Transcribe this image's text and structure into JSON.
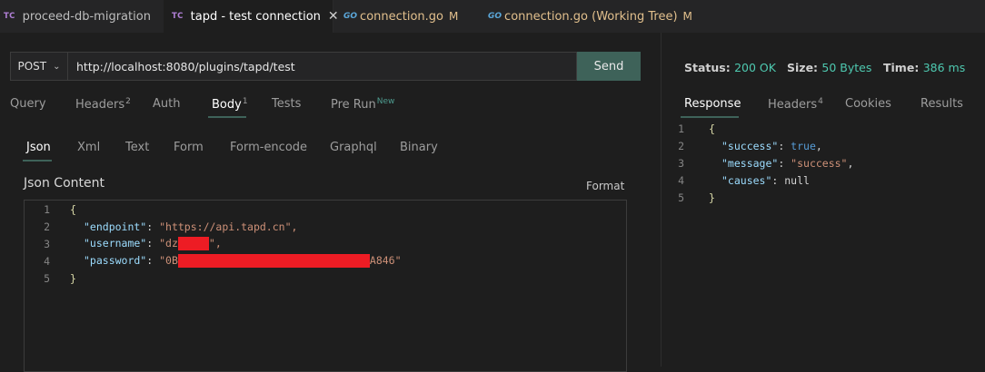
{
  "tabs": [
    {
      "icon": "TC",
      "label": "proceed-db-migration"
    },
    {
      "icon": "TC",
      "label": "tapd - test connection"
    },
    {
      "icon": "GO",
      "label": "connection.go",
      "modified": "M"
    },
    {
      "icon": "GO",
      "label": "connection.go (Working Tree)",
      "modified": "M"
    }
  ],
  "request": {
    "method": "POST",
    "url": "http://localhost:8080/plugins/tapd/test",
    "send_label": "Send"
  },
  "request_tabs": [
    {
      "label": "Query"
    },
    {
      "label": "Headers",
      "badge": "2"
    },
    {
      "label": "Auth"
    },
    {
      "label": "Body",
      "badge": "1"
    },
    {
      "label": "Tests"
    },
    {
      "label": "Pre Run",
      "badge": "New"
    }
  ],
  "body_tabs": [
    "Json",
    "Xml",
    "Text",
    "Form",
    "Form-encode",
    "Graphql",
    "Binary"
  ],
  "json_content": {
    "title": "Json Content",
    "format_label": "Format",
    "lines": [
      {
        "n": "1",
        "brace": "{"
      },
      {
        "n": "2",
        "key": "\"endpoint\"",
        "value": "\"https://api.tapd.cn\","
      },
      {
        "n": "3",
        "key": "\"username\"",
        "value_start": "\"dz",
        "value_end": "\","
      },
      {
        "n": "4",
        "key": "\"password\"",
        "value_start": "\"0B",
        "value_end": "A846\""
      },
      {
        "n": "5",
        "brace": "}"
      }
    ]
  },
  "response": {
    "status_label": "Status:",
    "status_value": "200 OK",
    "size_label": "Size:",
    "size_value": "50 Bytes",
    "time_label": "Time:",
    "time_value": "386 ms",
    "tabs": [
      {
        "label": "Response"
      },
      {
        "label": "Headers",
        "badge": "4"
      },
      {
        "label": "Cookies"
      },
      {
        "label": "Results"
      }
    ],
    "lines": [
      {
        "n": "1",
        "brace": "{"
      },
      {
        "n": "2",
        "key": "\"success\"",
        "value": "true",
        "tail": ","
      },
      {
        "n": "3",
        "key": "\"message\"",
        "value": "\"success\"",
        "tail": ","
      },
      {
        "n": "4",
        "key": "\"causes\"",
        "value": "null",
        "tail": ""
      },
      {
        "n": "5",
        "brace": "}"
      }
    ]
  },
  "colors": {
    "accent": "#3e6259",
    "string": "#ce9178",
    "key": "#9cdcfe",
    "status_ok": "#4ec9b0",
    "redaction": "#ed1c24"
  }
}
